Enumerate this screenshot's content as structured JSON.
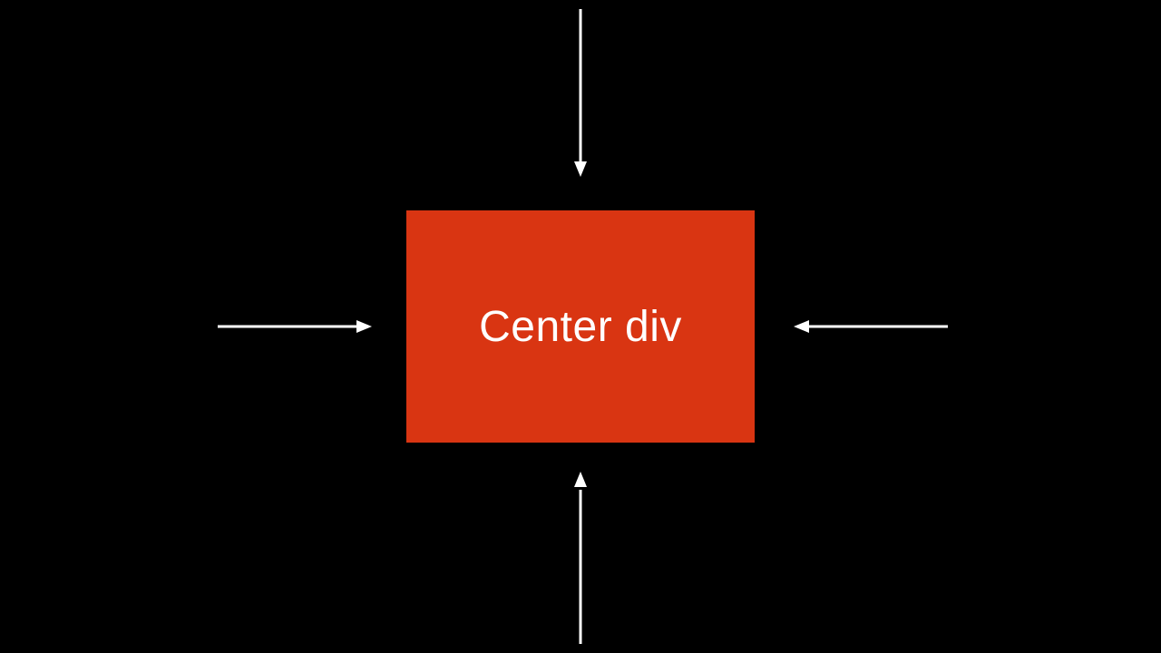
{
  "colors": {
    "background": "#000000",
    "box": "#d93512",
    "arrow": "#ffffff",
    "text": "#ffffff"
  },
  "box": {
    "label": "Center div"
  },
  "arrows": {
    "top": "arrow-down-icon",
    "bottom": "arrow-up-icon",
    "left": "arrow-right-icon",
    "right": "arrow-left-icon"
  }
}
